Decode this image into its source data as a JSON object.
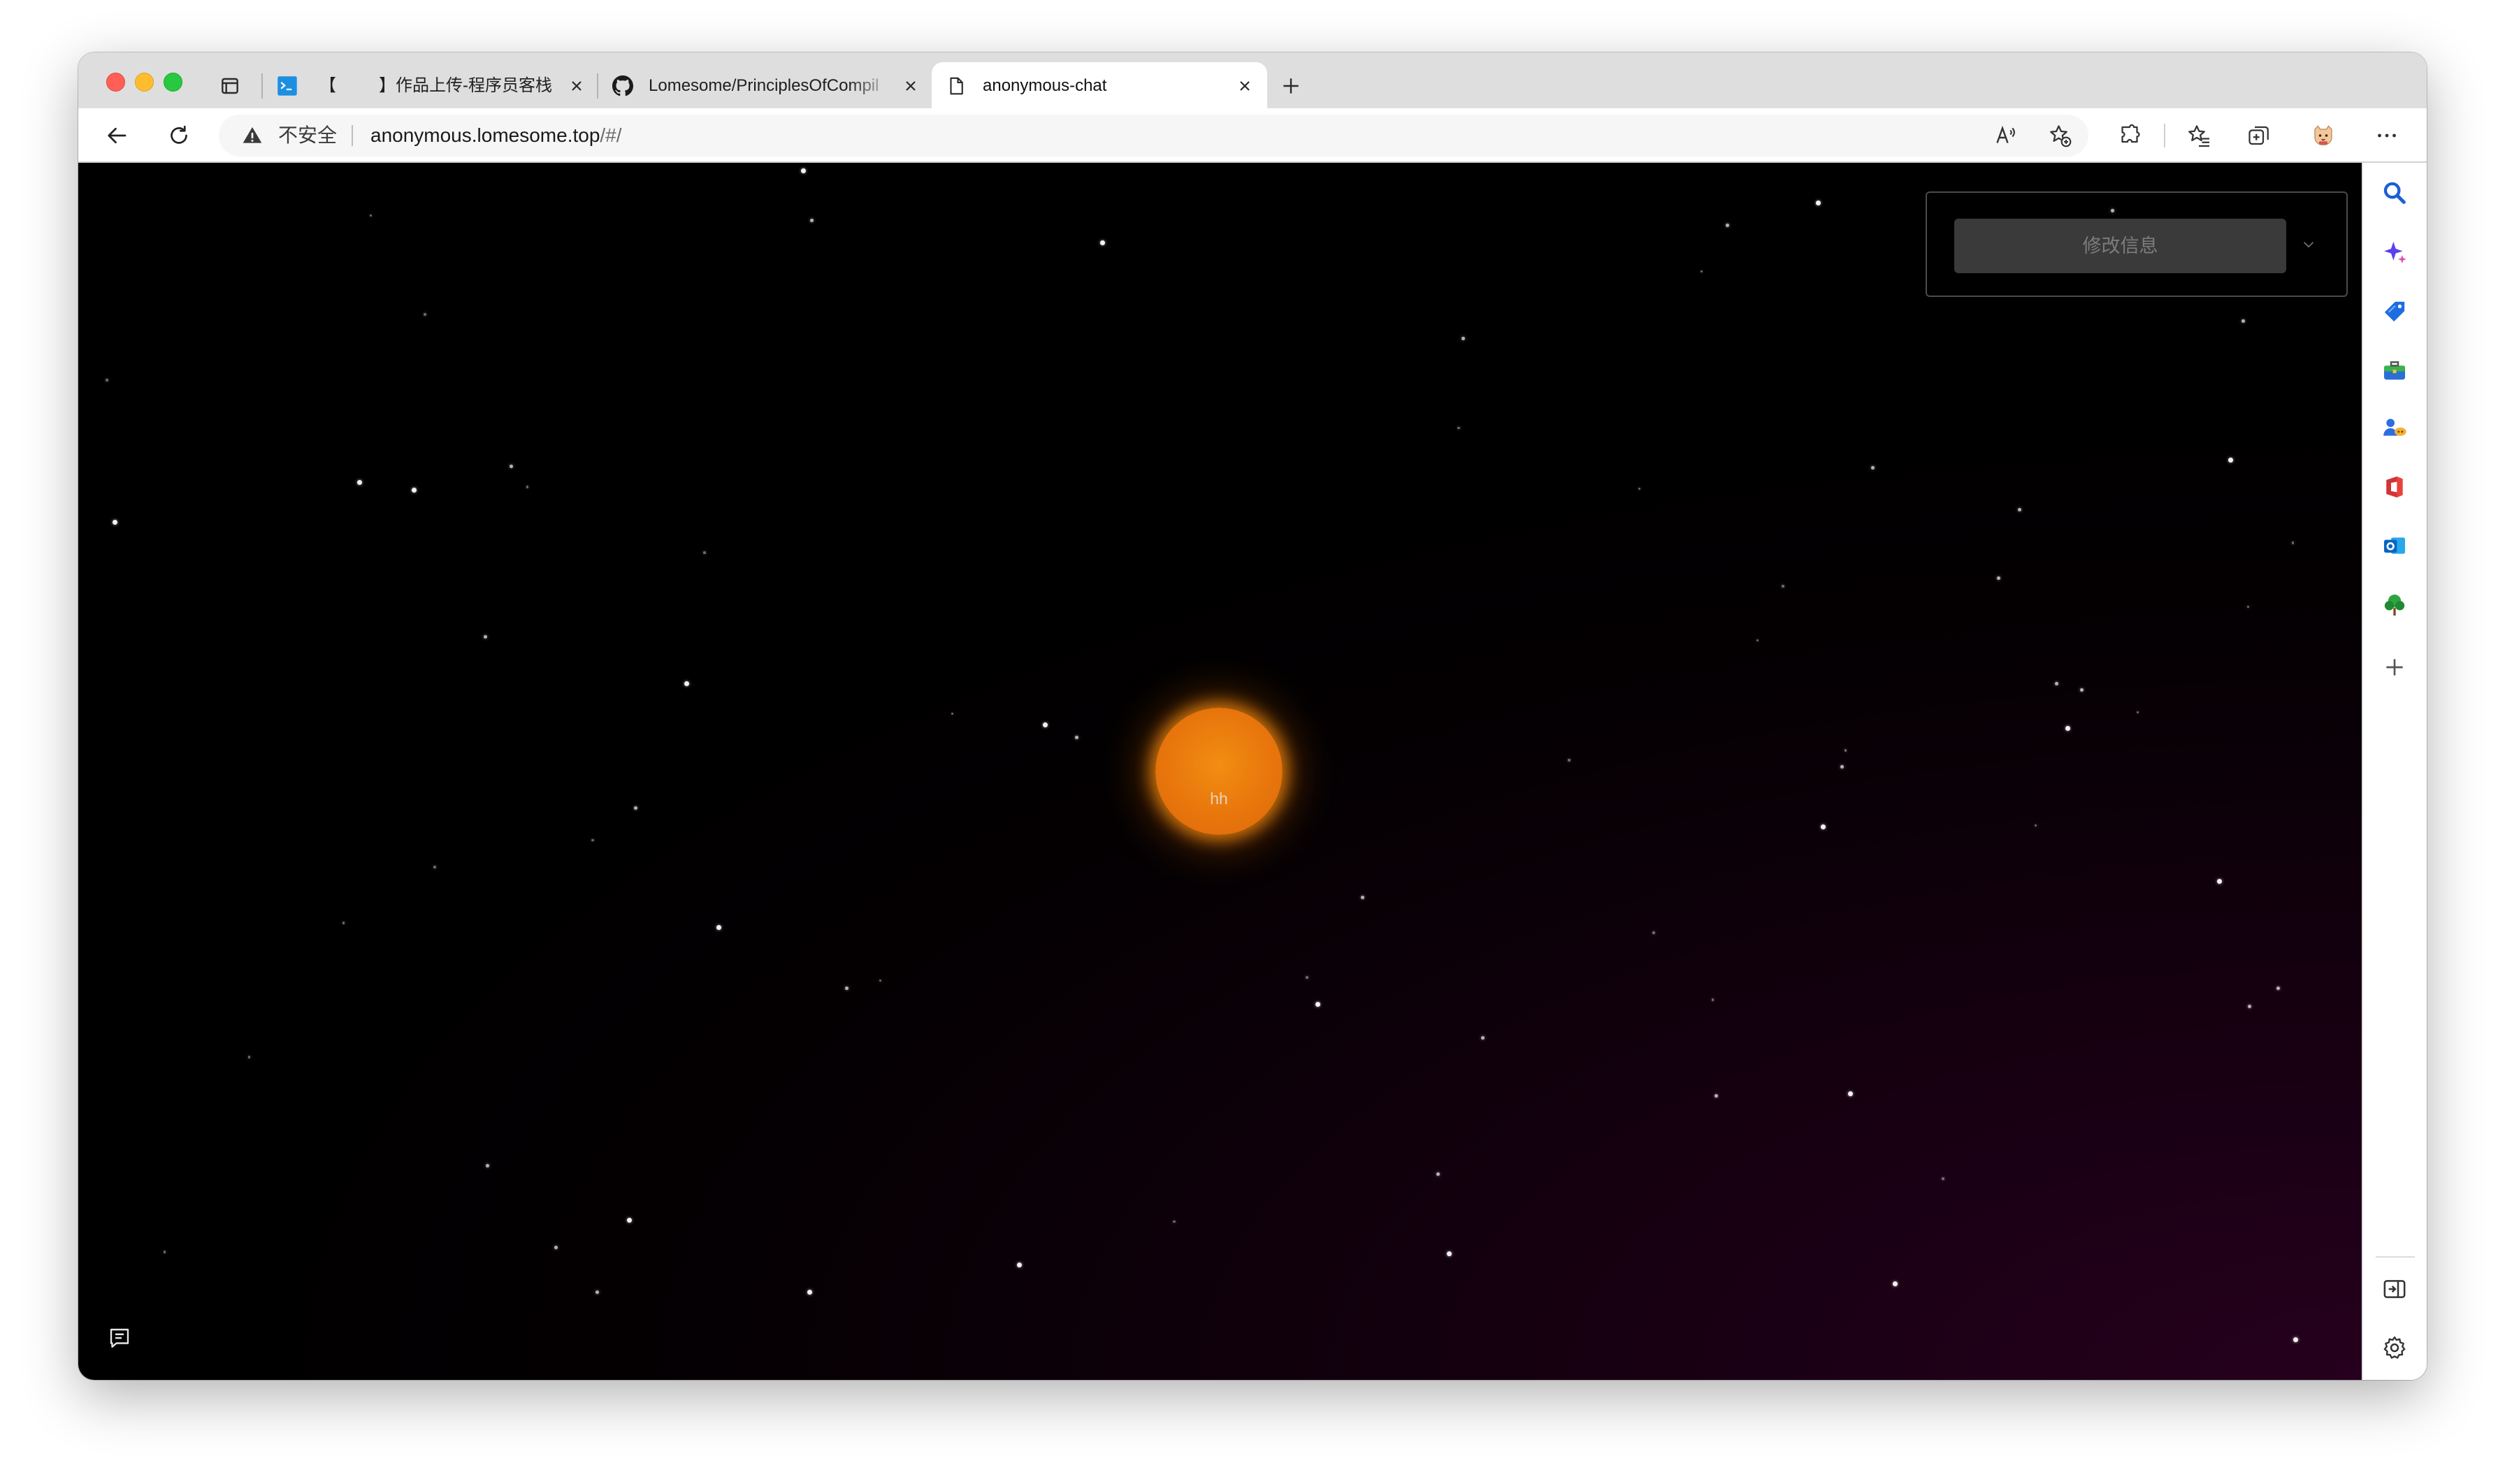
{
  "tabs": [
    {
      "icon": "terminal-icon",
      "title_left": "【",
      "title_right": "】作品上传-程序员客栈"
    },
    {
      "icon": "github-icon",
      "title": "Lomesome/PrinciplesOfCompil"
    },
    {
      "icon": "page-icon",
      "title": "anonymous-chat",
      "active": true
    }
  ],
  "address_bar": {
    "security_label": "不安全",
    "host": "anonymous.lomesome.top",
    "path": "/#/"
  },
  "toolbar_icons": [
    "back-arrow-icon",
    "refresh-icon",
    "warning-icon",
    "read-aloud-icon",
    "add-favorite-icon",
    "extensions-icon",
    "favorites-icon",
    "collections-icon",
    "profile-icon",
    "more-icon"
  ],
  "page": {
    "user_label": "hh",
    "edit_button": "修改信息",
    "orb_color": "#e8760c",
    "background_accent": "#26001e"
  },
  "sidebar_icons": [
    "search-icon",
    "copilot-icon",
    "shopping-tag-icon",
    "tools-icon",
    "games-icon",
    "office-icon",
    "outlook-icon",
    "tree-icon",
    "add-icon",
    "sidebar-toggle-icon",
    "settings-icon"
  ]
}
